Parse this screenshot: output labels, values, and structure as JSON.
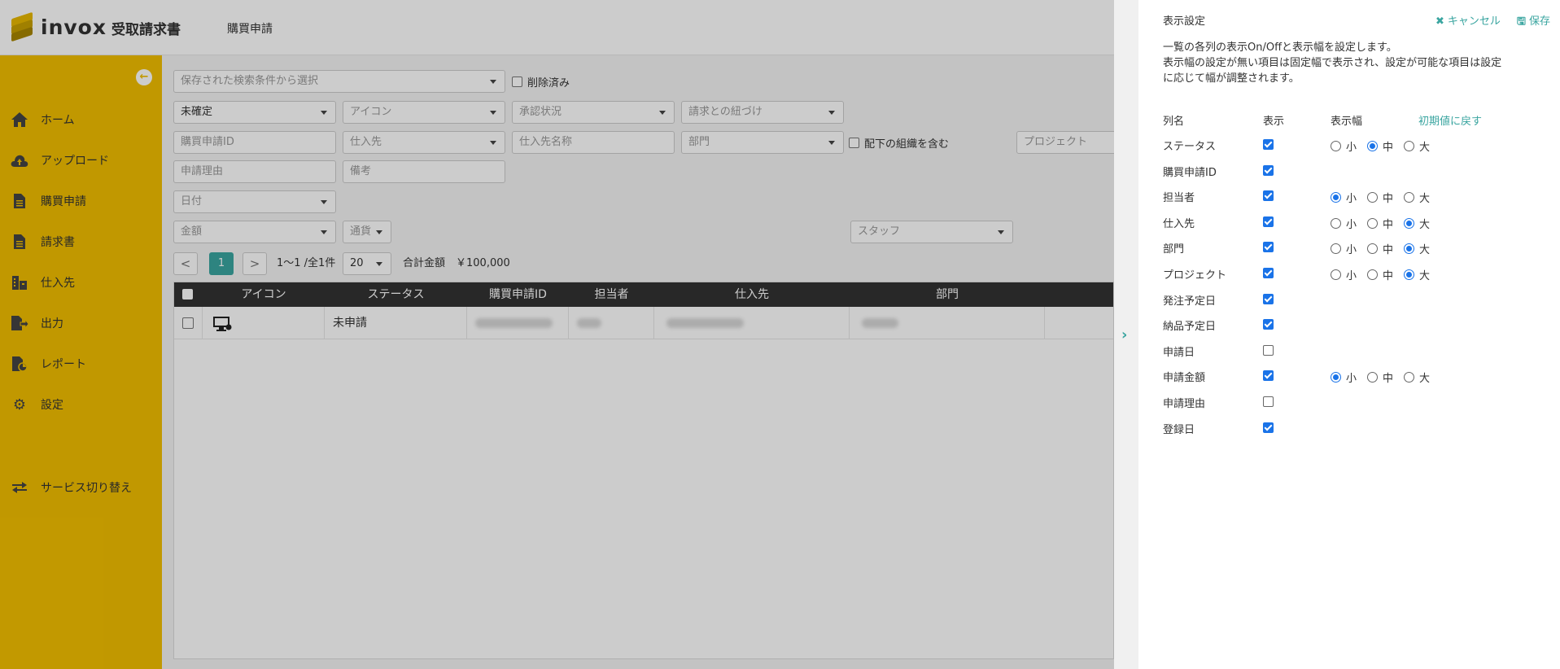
{
  "app": {
    "logo_word": "invox",
    "logo_sub": "受取請求書",
    "page_title": "購買申請",
    "brand_color": "#f2bf00",
    "accent_color": "#3aa5a0"
  },
  "sidebar": {
    "items": [
      {
        "label": "ホーム",
        "icon": "home-icon"
      },
      {
        "label": "アップロード",
        "icon": "upload-icon"
      },
      {
        "label": "購買申請",
        "icon": "document-icon"
      },
      {
        "label": "請求書",
        "icon": "invoice-icon"
      },
      {
        "label": "仕入先",
        "icon": "building-icon"
      },
      {
        "label": "出力",
        "icon": "export-icon"
      },
      {
        "label": "レポート",
        "icon": "report-icon"
      },
      {
        "label": "設定",
        "icon": "gear-icon"
      }
    ],
    "service_switch": "サービス切り替え"
  },
  "filters": {
    "saved_search": "保存された検索条件から選択",
    "deleted": "削除済み",
    "status_select": "未確定",
    "icon_select": "アイコン",
    "approval_select": "承認状況",
    "invoice_link_select": "請求との紐づけ",
    "request_id": "購買申請ID",
    "supplier_select": "仕入先",
    "supplier_name": "仕入先名称",
    "department_select": "部門",
    "include_sub_org": "配下の組織を含む",
    "project": "プロジェクト",
    "reason": "申請理由",
    "note": "備考",
    "date_select": "日付",
    "amount_select": "金額",
    "currency_select": "通貨",
    "staff_select": "スタッフ"
  },
  "pager": {
    "prev": "<",
    "current": "1",
    "next": ">",
    "range": "1〜1 /全1件",
    "per_page": "20",
    "total_label": "合計金額",
    "total_value": "￥100,000"
  },
  "table": {
    "columns": [
      "アイコン",
      "ステータス",
      "購買申請ID",
      "担当者",
      "仕入先",
      "部門"
    ],
    "rows": [
      {
        "icon": "computer-icon",
        "status": "未申請"
      }
    ]
  },
  "panel": {
    "title": "表示設定",
    "cancel": "キャンセル",
    "save": "保存",
    "desc_line1": "一覧の各列の表示On/Offと表示幅を設定します。",
    "desc_line2": "表示幅の設定が無い項目は固定幅で表示され、設定が可能な項目は設定",
    "desc_line3": "に応じて幅が調整されます。",
    "col_name": "列名",
    "col_show": "表示",
    "col_width": "表示幅",
    "reset": "初期値に戻す",
    "width_small": "小",
    "width_medium": "中",
    "width_large": "大",
    "rows": [
      {
        "name": "ステータス",
        "shown": true,
        "width": "中"
      },
      {
        "name": "購買申請ID",
        "shown": true,
        "width": null
      },
      {
        "name": "担当者",
        "shown": true,
        "width": "小"
      },
      {
        "name": "仕入先",
        "shown": true,
        "width": "大"
      },
      {
        "name": "部門",
        "shown": true,
        "width": "大"
      },
      {
        "name": "プロジェクト",
        "shown": true,
        "width": "大"
      },
      {
        "name": "発注予定日",
        "shown": true,
        "width": null
      },
      {
        "name": "納品予定日",
        "shown": true,
        "width": null
      },
      {
        "name": "申請日",
        "shown": false,
        "width": null
      },
      {
        "name": "申請金額",
        "shown": true,
        "width": "小"
      },
      {
        "name": "申請理由",
        "shown": false,
        "width": null
      },
      {
        "name": "登録日",
        "shown": true,
        "width": null
      }
    ]
  }
}
